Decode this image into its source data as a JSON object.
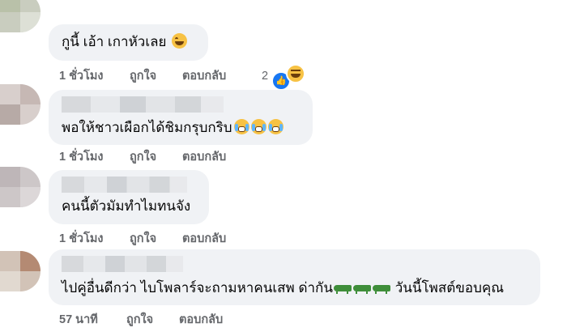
{
  "comments": [
    {
      "text": "กูนี้ เอ้า เกาหัวเลย",
      "time": "1 ชั่วโมง",
      "like": "ถูกใจ",
      "reply": "ตอบกลับ",
      "reaction_count": "2"
    },
    {
      "text": "พอให้ชาวเผือกได้ชิมกรุบกริบ",
      "time": "1 ชั่วโมง",
      "like": "ถูกใจ",
      "reply": "ตอบกลับ"
    },
    {
      "text": "คนนี้ตัวมัมทำไมทนจัง",
      "time": "1 ชั่วโมง",
      "like": "ถูกใจ",
      "reply": "ตอบกลับ"
    },
    {
      "text_a": "ไปคู่อื่นดีกว่า ไบโพลาร์จะถามหาคนเสพ ด่ากัน",
      "text_b": "วันนี้โพสต์ขอบคุณ",
      "time": "57 นาที",
      "like": "ถูกใจ",
      "reply": "ตอบกลับ"
    }
  ],
  "icons": {
    "laugh": "grinning-squinting-face-icon",
    "cry": "face-with-tears-icon",
    "croc": "crocodile-icon",
    "like": "like-reaction-icon",
    "haha": "haha-reaction-icon"
  },
  "colors": {
    "bubble": "#f0f2f5",
    "meta": "#65676b",
    "like_blue": "#1877f2"
  }
}
